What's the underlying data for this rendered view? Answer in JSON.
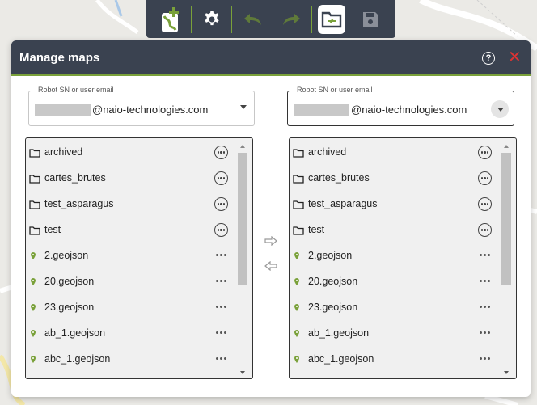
{
  "toolbar": {
    "buttons": [
      {
        "name": "add-map-button",
        "icon": "map-plus-icon"
      },
      {
        "name": "settings-button",
        "icon": "gear-icon"
      },
      {
        "name": "undo-button",
        "icon": "undo-icon"
      },
      {
        "name": "redo-button",
        "icon": "redo-icon"
      },
      {
        "name": "manage-maps-button",
        "icon": "folder-transfer-icon",
        "active": true
      },
      {
        "name": "save-button",
        "icon": "save-icon"
      }
    ],
    "accent_color": "#7aa13a"
  },
  "dialog": {
    "title": "Manage maps",
    "help_icon": "?",
    "close_icon": "✕",
    "header_color": "#3a4250",
    "close_color": "#dd3333"
  },
  "left_panel": {
    "select_legend": "Robot SN or user email",
    "select_value": "@naio-technologies.com",
    "items": [
      {
        "name": "archived",
        "type": "folder"
      },
      {
        "name": "cartes_brutes",
        "type": "folder"
      },
      {
        "name": "test_asparagus",
        "type": "folder"
      },
      {
        "name": "test",
        "type": "folder"
      },
      {
        "name": "2.geojson",
        "type": "file"
      },
      {
        "name": "20.geojson",
        "type": "file"
      },
      {
        "name": "23.geojson",
        "type": "file"
      },
      {
        "name": "ab_1.geojson",
        "type": "file"
      },
      {
        "name": "abc_1.geojson",
        "type": "file"
      }
    ]
  },
  "right_panel": {
    "select_legend": "Robot SN or user email",
    "select_value": "@naio-technologies.com",
    "items": [
      {
        "name": "archived",
        "type": "folder"
      },
      {
        "name": "cartes_brutes",
        "type": "folder"
      },
      {
        "name": "test_asparagus",
        "type": "folder"
      },
      {
        "name": "test",
        "type": "folder"
      },
      {
        "name": "2.geojson",
        "type": "file"
      },
      {
        "name": "20.geojson",
        "type": "file"
      },
      {
        "name": "23.geojson",
        "type": "file"
      },
      {
        "name": "ab_1.geojson",
        "type": "file"
      },
      {
        "name": "abc_1.geojson",
        "type": "file"
      }
    ]
  },
  "transfer": {
    "right_icon": "arrow-right-icon",
    "left_icon": "arrow-left-icon"
  }
}
